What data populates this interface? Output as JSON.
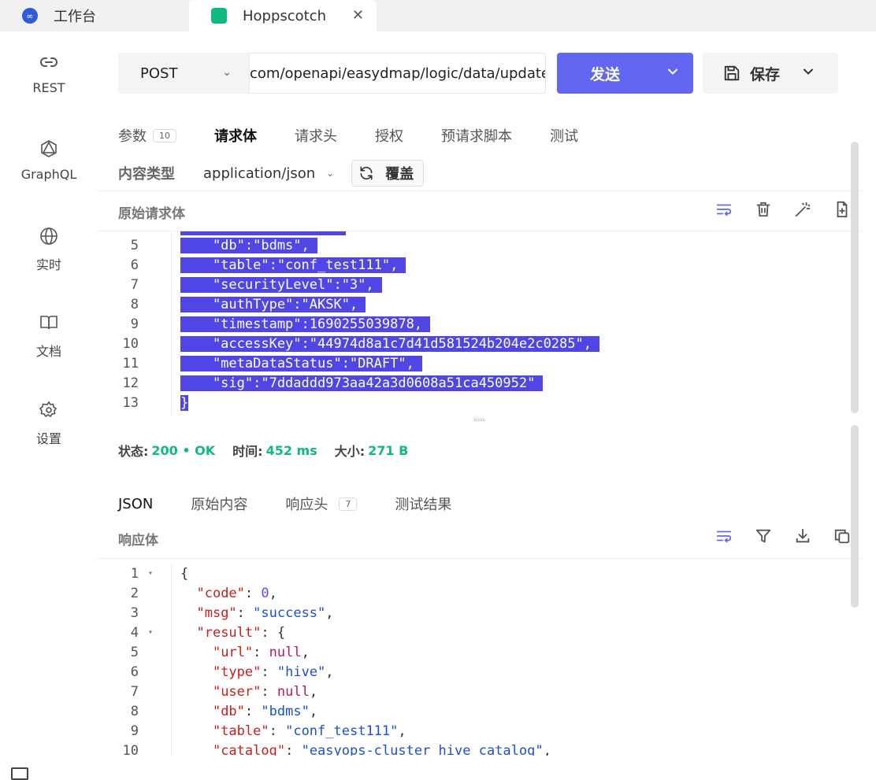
{
  "browser_tabs": [
    {
      "title": "工作台"
    },
    {
      "title": "Hoppscotch"
    }
  ],
  "sidebar": {
    "items": [
      {
        "label": "REST",
        "icon": "rest-link-icon"
      },
      {
        "label": "GraphQL",
        "icon": "graphql-icon"
      },
      {
        "label": "实时",
        "icon": "globe-icon"
      },
      {
        "label": "文档",
        "icon": "book-icon"
      },
      {
        "label": "设置",
        "icon": "gear-icon"
      }
    ]
  },
  "request": {
    "method": "POST",
    "url": "com/openapi/easydmap/logic/data/update",
    "send_label": "发送",
    "save_label": "保存"
  },
  "request_tabs": [
    {
      "label": "参数",
      "count": "10"
    },
    {
      "label": "请求体"
    },
    {
      "label": "请求头"
    },
    {
      "label": "授权"
    },
    {
      "label": "预请求脚本"
    },
    {
      "label": "测试"
    }
  ],
  "content_type": {
    "label": "内容类型",
    "value": "application/json",
    "override_label": "覆盖"
  },
  "raw_body": {
    "title": "原始请求体",
    "lines": [
      {
        "n": "5",
        "text": "    \"db\":\"bdms\","
      },
      {
        "n": "6",
        "text": "    \"table\":\"conf_test111\","
      },
      {
        "n": "7",
        "text": "    \"securityLevel\":\"3\","
      },
      {
        "n": "8",
        "text": "    \"authType\":\"AKSK\","
      },
      {
        "n": "9",
        "text": "    \"timestamp\":1690255039878,"
      },
      {
        "n": "10",
        "text": "    \"accessKey\":\"44974d8a1c7d41d581524b204e2c0285\","
      },
      {
        "n": "11",
        "text": "    \"metaDataStatus\":\"DRAFT\","
      },
      {
        "n": "12",
        "text": "    \"sig\":\"7ddaddd973aa42a3d0608a51ca450952\""
      },
      {
        "n": "13",
        "text": "}"
      }
    ]
  },
  "status": {
    "status_label": "状态:",
    "status_value": "200 • OK",
    "time_label": "时间:",
    "time_value": "452 ms",
    "size_label": "大小:",
    "size_value": "271 B"
  },
  "response_tabs": [
    {
      "label": "JSON"
    },
    {
      "label": "原始内容"
    },
    {
      "label": "响应头",
      "count": "7"
    },
    {
      "label": "测试结果"
    }
  ],
  "response_body": {
    "title": "响应体",
    "lines": [
      {
        "n": "1",
        "fold": true
      },
      {
        "n": "2"
      },
      {
        "n": "3"
      },
      {
        "n": "4",
        "fold": true
      },
      {
        "n": "5"
      },
      {
        "n": "6"
      },
      {
        "n": "7"
      },
      {
        "n": "8"
      },
      {
        "n": "9"
      },
      {
        "n": "10"
      }
    ],
    "tokens": {
      "l1": "{",
      "l2_key": "\"code\"",
      "l2_val": "0",
      "l3_key": "\"msg\"",
      "l3_val": "\"success\"",
      "l4_key": "\"result\"",
      "l4_val": "{",
      "l5_key": "\"url\"",
      "l5_val": "null",
      "l6_key": "\"type\"",
      "l6_val": "\"hive\"",
      "l7_key": "\"user\"",
      "l7_val": "null",
      "l8_key": "\"db\"",
      "l8_val": "\"bdms\"",
      "l9_key": "\"table\"",
      "l9_val": "\"conf_test111\"",
      "l10_key": "\"catalog\"",
      "l10_val": "\"easyops-cluster hive catalog\""
    }
  }
}
